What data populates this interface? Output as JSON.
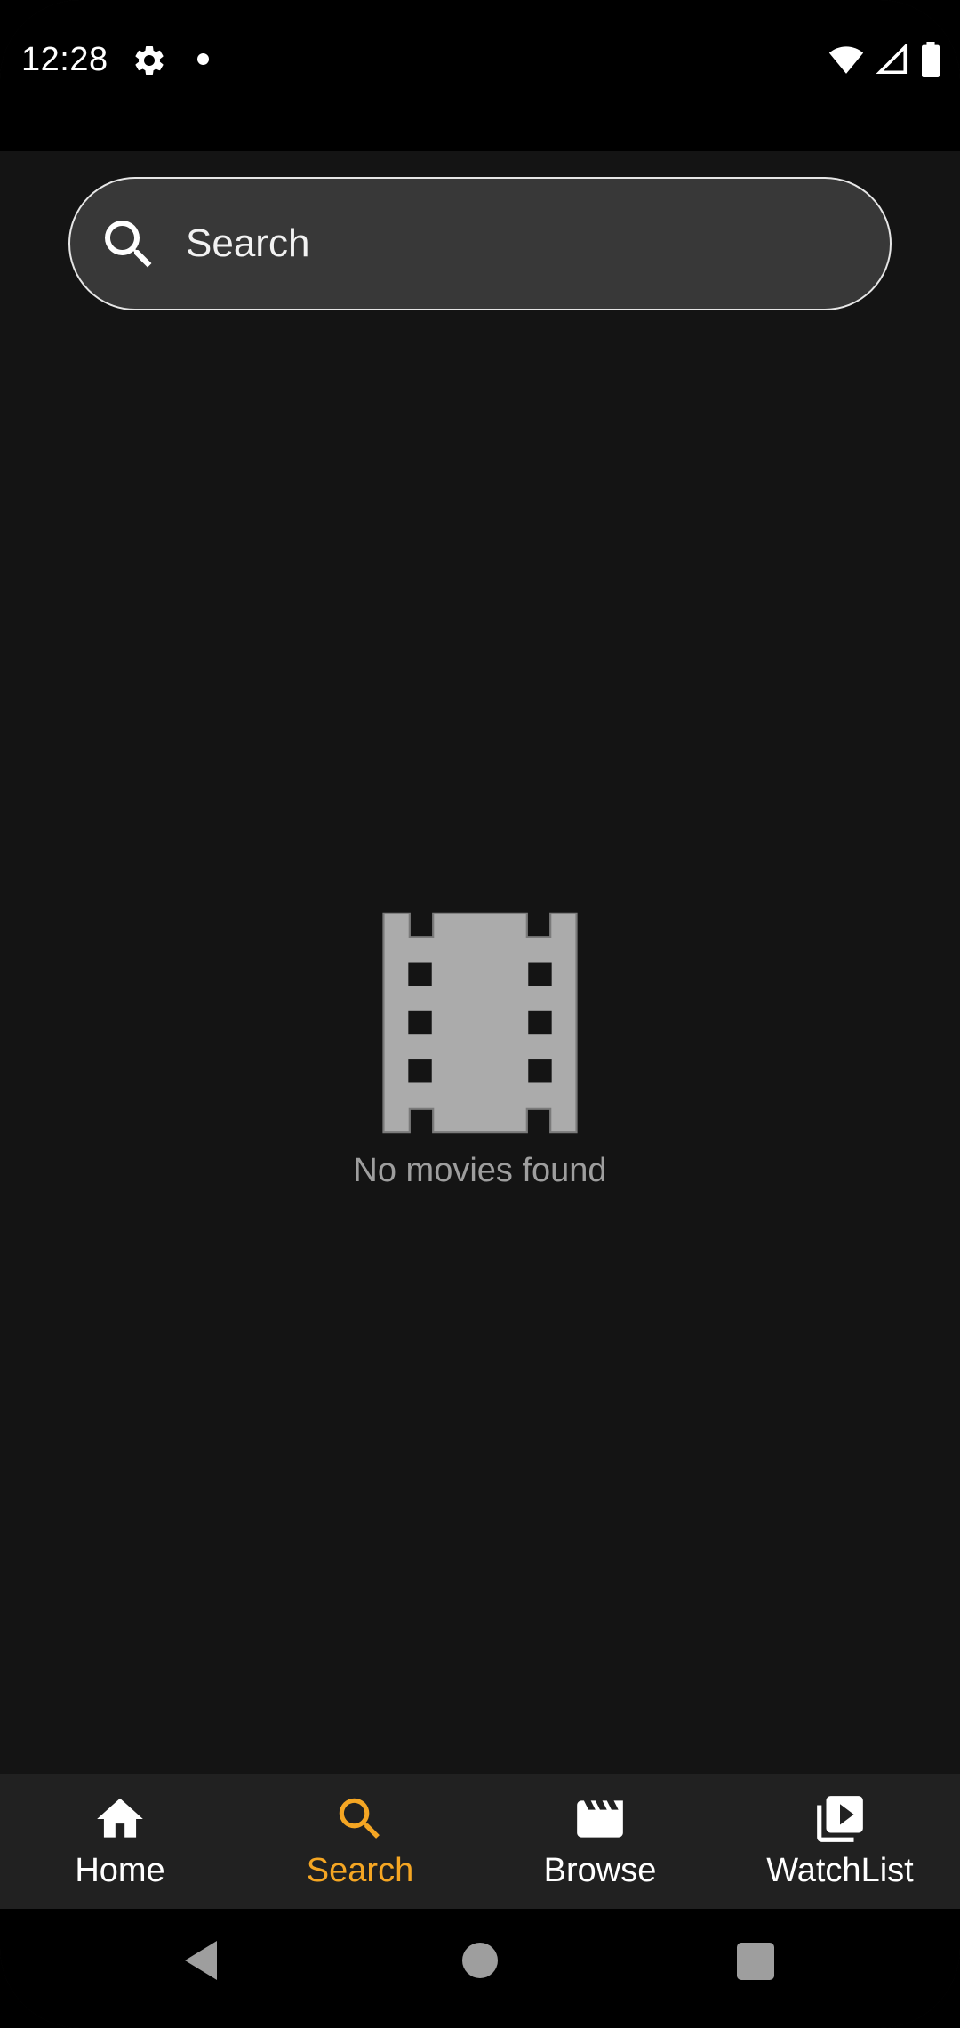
{
  "status_bar": {
    "time": "12:28",
    "icons": [
      "gear-icon",
      "notification-dot-icon",
      "wifi-icon",
      "signal-icon",
      "battery-icon"
    ]
  },
  "search": {
    "placeholder": "Search",
    "value": ""
  },
  "empty_state": {
    "icon": "film-icon",
    "message": "No movies found"
  },
  "bottom_nav": {
    "items": [
      {
        "label": "Home",
        "icon": "home-icon",
        "active": false
      },
      {
        "label": "Search",
        "icon": "search-icon",
        "active": true
      },
      {
        "label": "Browse",
        "icon": "clapperboard-icon",
        "active": false
      },
      {
        "label": "WatchList",
        "icon": "video-library-icon",
        "active": false
      }
    ]
  },
  "colors": {
    "background": "#141414",
    "accent": "#f5a623",
    "search_fill": "#383838",
    "nav_background": "#212121",
    "muted_text": "#9e9e9e"
  }
}
